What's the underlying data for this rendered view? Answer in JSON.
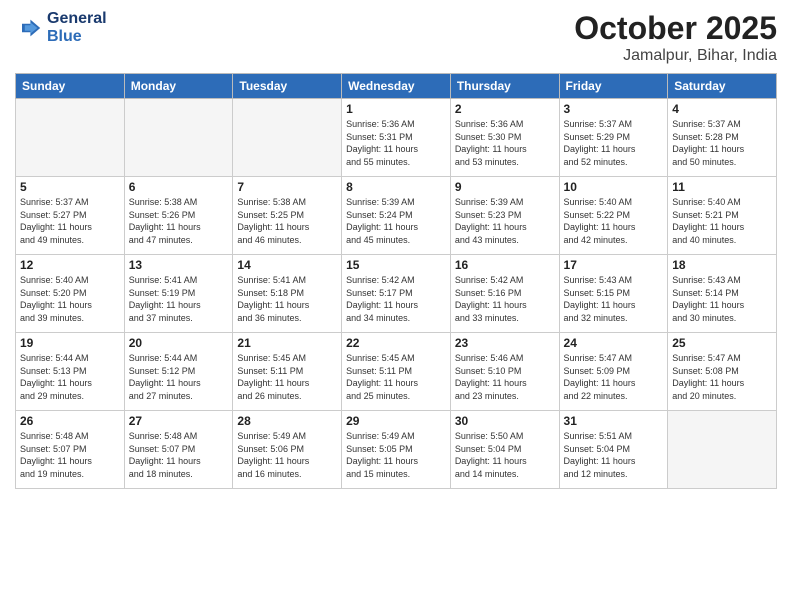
{
  "header": {
    "logo_line1": "General",
    "logo_line2": "Blue",
    "month": "October 2025",
    "location": "Jamalpur, Bihar, India"
  },
  "weekdays": [
    "Sunday",
    "Monday",
    "Tuesday",
    "Wednesday",
    "Thursday",
    "Friday",
    "Saturday"
  ],
  "weeks": [
    [
      {
        "day": "",
        "info": ""
      },
      {
        "day": "",
        "info": ""
      },
      {
        "day": "",
        "info": ""
      },
      {
        "day": "1",
        "info": "Sunrise: 5:36 AM\nSunset: 5:31 PM\nDaylight: 11 hours\nand 55 minutes."
      },
      {
        "day": "2",
        "info": "Sunrise: 5:36 AM\nSunset: 5:30 PM\nDaylight: 11 hours\nand 53 minutes."
      },
      {
        "day": "3",
        "info": "Sunrise: 5:37 AM\nSunset: 5:29 PM\nDaylight: 11 hours\nand 52 minutes."
      },
      {
        "day": "4",
        "info": "Sunrise: 5:37 AM\nSunset: 5:28 PM\nDaylight: 11 hours\nand 50 minutes."
      }
    ],
    [
      {
        "day": "5",
        "info": "Sunrise: 5:37 AM\nSunset: 5:27 PM\nDaylight: 11 hours\nand 49 minutes."
      },
      {
        "day": "6",
        "info": "Sunrise: 5:38 AM\nSunset: 5:26 PM\nDaylight: 11 hours\nand 47 minutes."
      },
      {
        "day": "7",
        "info": "Sunrise: 5:38 AM\nSunset: 5:25 PM\nDaylight: 11 hours\nand 46 minutes."
      },
      {
        "day": "8",
        "info": "Sunrise: 5:39 AM\nSunset: 5:24 PM\nDaylight: 11 hours\nand 45 minutes."
      },
      {
        "day": "9",
        "info": "Sunrise: 5:39 AM\nSunset: 5:23 PM\nDaylight: 11 hours\nand 43 minutes."
      },
      {
        "day": "10",
        "info": "Sunrise: 5:40 AM\nSunset: 5:22 PM\nDaylight: 11 hours\nand 42 minutes."
      },
      {
        "day": "11",
        "info": "Sunrise: 5:40 AM\nSunset: 5:21 PM\nDaylight: 11 hours\nand 40 minutes."
      }
    ],
    [
      {
        "day": "12",
        "info": "Sunrise: 5:40 AM\nSunset: 5:20 PM\nDaylight: 11 hours\nand 39 minutes."
      },
      {
        "day": "13",
        "info": "Sunrise: 5:41 AM\nSunset: 5:19 PM\nDaylight: 11 hours\nand 37 minutes."
      },
      {
        "day": "14",
        "info": "Sunrise: 5:41 AM\nSunset: 5:18 PM\nDaylight: 11 hours\nand 36 minutes."
      },
      {
        "day": "15",
        "info": "Sunrise: 5:42 AM\nSunset: 5:17 PM\nDaylight: 11 hours\nand 34 minutes."
      },
      {
        "day": "16",
        "info": "Sunrise: 5:42 AM\nSunset: 5:16 PM\nDaylight: 11 hours\nand 33 minutes."
      },
      {
        "day": "17",
        "info": "Sunrise: 5:43 AM\nSunset: 5:15 PM\nDaylight: 11 hours\nand 32 minutes."
      },
      {
        "day": "18",
        "info": "Sunrise: 5:43 AM\nSunset: 5:14 PM\nDaylight: 11 hours\nand 30 minutes."
      }
    ],
    [
      {
        "day": "19",
        "info": "Sunrise: 5:44 AM\nSunset: 5:13 PM\nDaylight: 11 hours\nand 29 minutes."
      },
      {
        "day": "20",
        "info": "Sunrise: 5:44 AM\nSunset: 5:12 PM\nDaylight: 11 hours\nand 27 minutes."
      },
      {
        "day": "21",
        "info": "Sunrise: 5:45 AM\nSunset: 5:11 PM\nDaylight: 11 hours\nand 26 minutes."
      },
      {
        "day": "22",
        "info": "Sunrise: 5:45 AM\nSunset: 5:11 PM\nDaylight: 11 hours\nand 25 minutes."
      },
      {
        "day": "23",
        "info": "Sunrise: 5:46 AM\nSunset: 5:10 PM\nDaylight: 11 hours\nand 23 minutes."
      },
      {
        "day": "24",
        "info": "Sunrise: 5:47 AM\nSunset: 5:09 PM\nDaylight: 11 hours\nand 22 minutes."
      },
      {
        "day": "25",
        "info": "Sunrise: 5:47 AM\nSunset: 5:08 PM\nDaylight: 11 hours\nand 20 minutes."
      }
    ],
    [
      {
        "day": "26",
        "info": "Sunrise: 5:48 AM\nSunset: 5:07 PM\nDaylight: 11 hours\nand 19 minutes."
      },
      {
        "day": "27",
        "info": "Sunrise: 5:48 AM\nSunset: 5:07 PM\nDaylight: 11 hours\nand 18 minutes."
      },
      {
        "day": "28",
        "info": "Sunrise: 5:49 AM\nSunset: 5:06 PM\nDaylight: 11 hours\nand 16 minutes."
      },
      {
        "day": "29",
        "info": "Sunrise: 5:49 AM\nSunset: 5:05 PM\nDaylight: 11 hours\nand 15 minutes."
      },
      {
        "day": "30",
        "info": "Sunrise: 5:50 AM\nSunset: 5:04 PM\nDaylight: 11 hours\nand 14 minutes."
      },
      {
        "day": "31",
        "info": "Sunrise: 5:51 AM\nSunset: 5:04 PM\nDaylight: 11 hours\nand 12 minutes."
      },
      {
        "day": "",
        "info": ""
      }
    ]
  ]
}
